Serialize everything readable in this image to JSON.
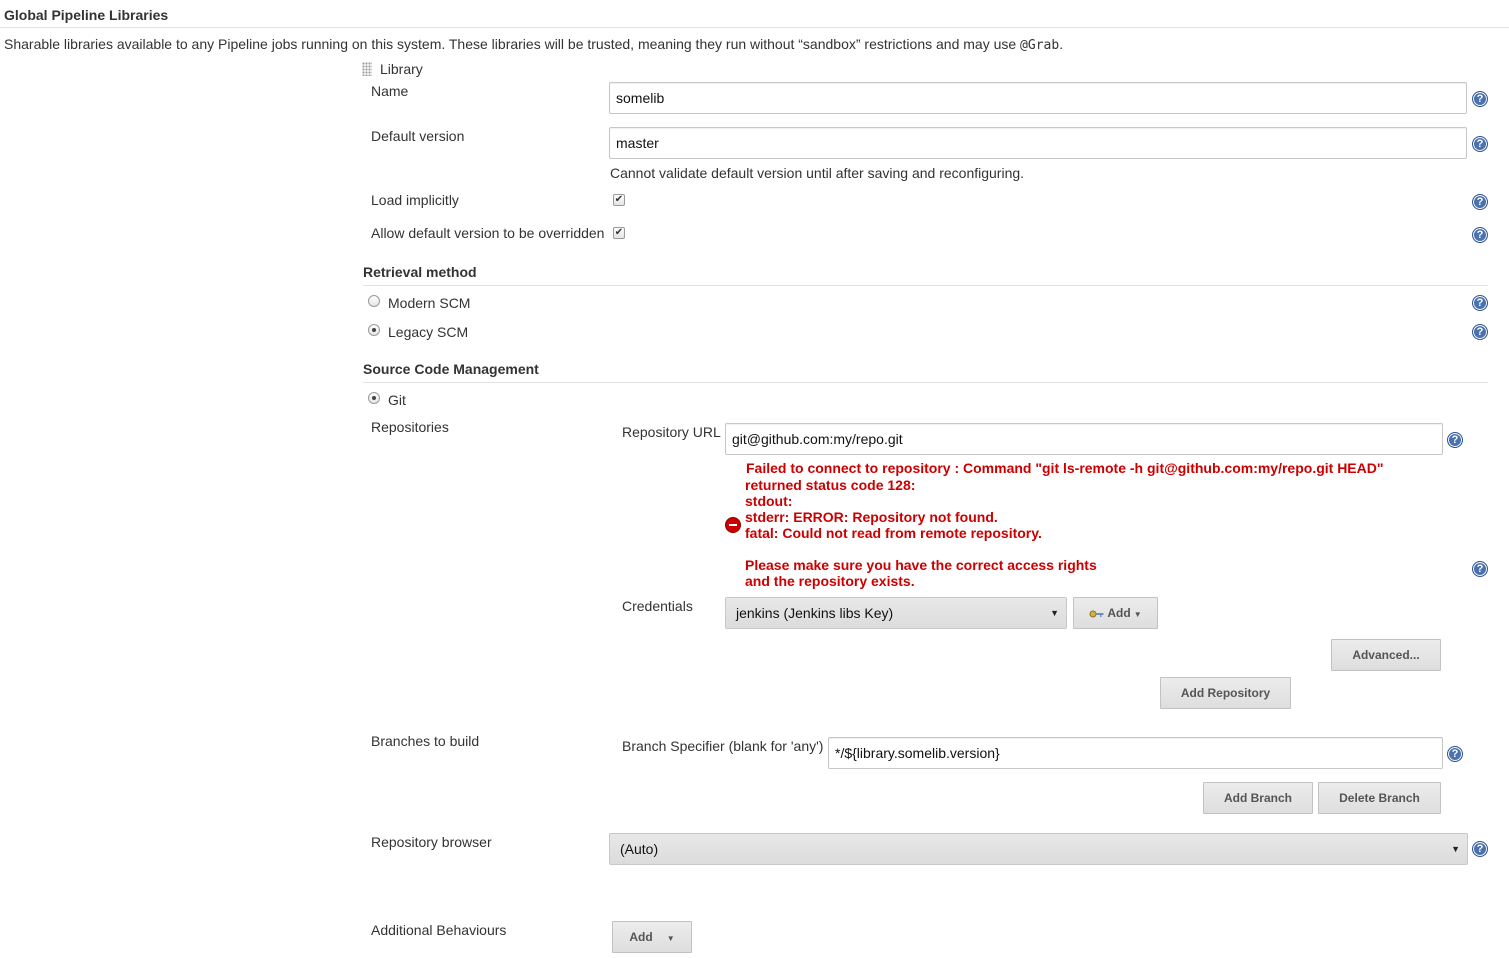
{
  "section": {
    "title": "Global Pipeline Libraries",
    "description_prefix": "Sharable libraries available to any Pipeline jobs running on this system. These libraries will be trusted, meaning they run without “sandbox” restrictions and may use ",
    "description_code": "@Grab",
    "description_suffix": "."
  },
  "library": {
    "header": "Library",
    "name_label": "Name",
    "name_value": "somelib",
    "default_version_label": "Default version",
    "default_version_value": "master",
    "default_version_note": "Cannot validate default version until after saving and reconfiguring.",
    "load_implicitly_label": "Load implicitly",
    "allow_override_label": "Allow default version to be overridden"
  },
  "retrieval": {
    "title": "Retrieval method",
    "options": [
      {
        "label": "Modern SCM",
        "checked": false
      },
      {
        "label": "Legacy SCM",
        "checked": true
      }
    ]
  },
  "scm": {
    "title": "Source Code Management",
    "git_label": "Git",
    "repositories_label": "Repositories",
    "repo_url_label": "Repository URL",
    "repo_url_value": "git@github.com:my/repo.git",
    "error_lines": [
      "Failed to connect to repository : Command \"git ls-remote -h git@github.com:my/repo.git HEAD\"",
      "returned status code 128:",
      "stdout:",
      "stderr: ERROR: Repository not found.",
      "fatal: Could not read from remote repository.",
      "",
      "Please make sure you have the correct access rights",
      "and the repository exists."
    ],
    "credentials_label": "Credentials",
    "credentials_value": "jenkins (Jenkins libs Key)",
    "add_credentials_label": "Add",
    "advanced_label": "Advanced...",
    "add_repository_label": "Add Repository",
    "branches_label": "Branches to build",
    "branch_spec_label": "Branch Specifier (blank for 'any')",
    "branch_spec_value": "*/${library.somelib.version}",
    "add_branch_label": "Add Branch",
    "delete_branch_label": "Delete Branch",
    "repo_browser_label": "Repository browser",
    "repo_browser_value": "(Auto)",
    "additional_behaviours_label": "Additional Behaviours",
    "add_behaviour_label": "Add"
  },
  "icons": {
    "help": "?",
    "check": "✔",
    "select_arrow": "▼",
    "key": "key-icon",
    "error": "error-icon"
  },
  "colors": {
    "error": "#cc0000",
    "help": "#4a71b0"
  }
}
